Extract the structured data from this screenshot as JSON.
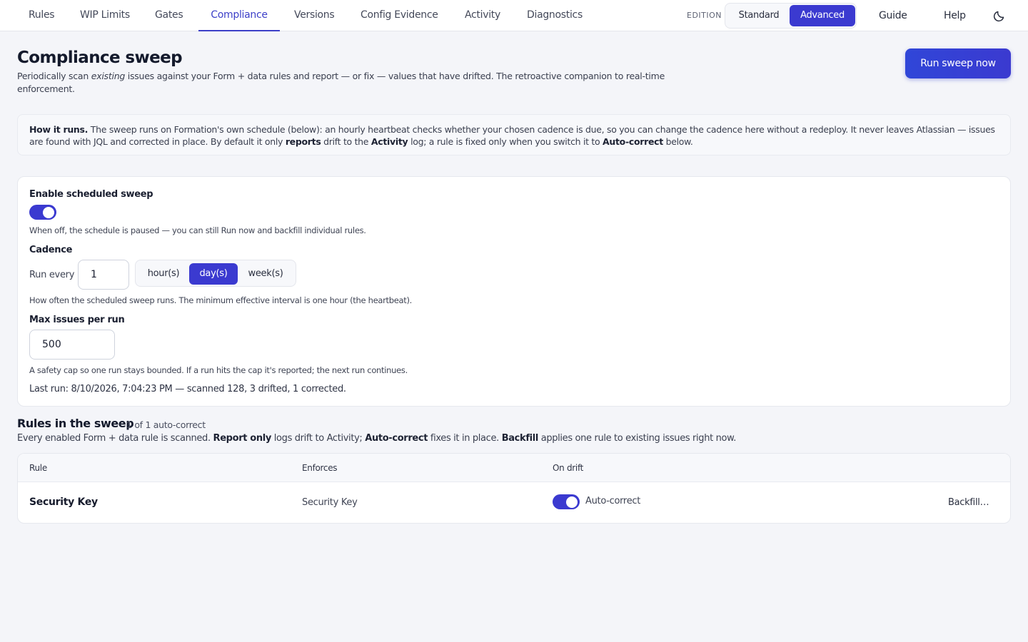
{
  "nav": {
    "tabs": [
      {
        "label": "Rules"
      },
      {
        "label": "WIP Limits"
      },
      {
        "label": "Gates"
      },
      {
        "label": "Compliance"
      },
      {
        "label": "Versions"
      },
      {
        "label": "Config Evidence"
      },
      {
        "label": "Activity"
      },
      {
        "label": "Diagnostics"
      }
    ],
    "active_tab": "Compliance",
    "edition_label": "EDITION",
    "edition_options": [
      "Standard",
      "Advanced"
    ],
    "edition_selected": "Advanced",
    "guide": "Guide",
    "help": "Help",
    "theme_icon": "moon-icon"
  },
  "header": {
    "title": "Compliance sweep",
    "subtitle_before": "Periodically scan ",
    "subtitle_em": "existing",
    "subtitle_after": " issues against your Form + data rules and report — or fix — values that have drifted. The retroactive companion to real-time enforcement.",
    "run_button": "Run sweep now"
  },
  "info": {
    "lead": "How it runs.",
    "text1": " The sweep runs on Formation's own schedule (below): an hourly heartbeat checks whether your chosen cadence is due, so you can change the cadence here without a redeploy. It never leaves Atlassian — issues are found with JQL and corrected in place. By default it only ",
    "bold1": "reports",
    "text2": " drift to the ",
    "bold2": "Activity",
    "text3": " log; a rule is fixed only when you switch it to ",
    "bold3": "Auto-correct",
    "text4": " below."
  },
  "settings": {
    "enable_label": "Enable scheduled sweep",
    "enable_on": true,
    "enable_hint": "When off, the schedule is paused — you can still Run now and backfill individual rules.",
    "cadence_label": "Cadence",
    "run_every_label": "Run every",
    "run_every_value": "1",
    "units": [
      "hour(s)",
      "day(s)",
      "week(s)"
    ],
    "unit_selected": "day(s)",
    "cadence_hint": "How often the scheduled sweep runs. The minimum effective interval is one hour (the heartbeat).",
    "max_label": "Max issues per run",
    "max_value": "500",
    "max_hint": "A safety cap so one run stays bounded. If a run hits the cap it's reported; the next run continues.",
    "last_run": "Last run: 8/10/2026, 7:04:23 PM — scanned 128, 3 drifted, 1 corrected."
  },
  "rules": {
    "title": "Rules in the sweep",
    "count": "1 of 1 auto-correct",
    "desc_1": "Every enabled Form + data rule is scanned. ",
    "desc_b1": "Report only",
    "desc_2": " logs drift to Activity; ",
    "desc_b2": "Auto-correct",
    "desc_3": " fixes it in place. ",
    "desc_b3": "Backfill",
    "desc_4": " applies one rule to existing issues right now.",
    "columns": [
      "Rule",
      "Enforces",
      "On drift"
    ],
    "rows": [
      {
        "rule": "Security Key",
        "enforces": "Security Key",
        "on_drift_on": true,
        "on_drift_label": "Auto-correct",
        "action": "Backfill…"
      }
    ]
  },
  "colors": {
    "accent": "#3b3ad0",
    "background": "#f4f5f9",
    "card": "#ffffff"
  }
}
